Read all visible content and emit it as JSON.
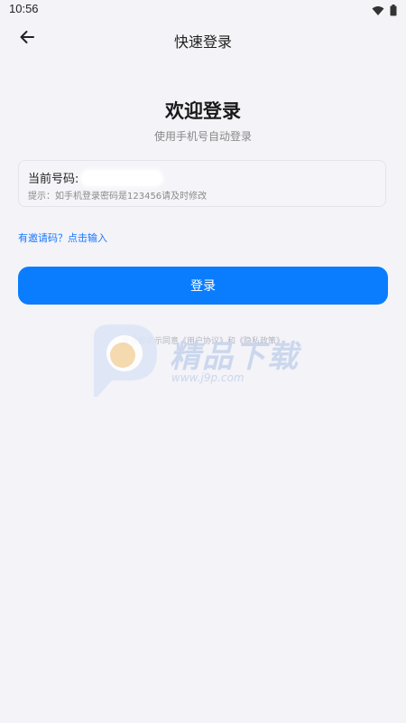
{
  "status_bar": {
    "time": "10:56"
  },
  "header": {
    "title": "快速登录"
  },
  "welcome": {
    "title": "欢迎登录",
    "subtitle": "使用手机号自动登录"
  },
  "phone_card": {
    "label": "当前号码:",
    "hint": "提示：如手机登录密码是123456请及时修改"
  },
  "invite": {
    "text": "有邀请码？点击输入"
  },
  "login_button": {
    "label": "登录"
  },
  "agreement": {
    "text": "登录即表示同意《用户协议》和《隐私政策》"
  },
  "watermark": {
    "brand": "精品下载",
    "url": "www.j9p.com"
  },
  "colors": {
    "accent": "#0a7dff",
    "link": "#1878ff",
    "background": "#f3f3f8"
  },
  "icons": {
    "back": "arrow-left",
    "wifi": "wifi",
    "battery": "battery"
  }
}
